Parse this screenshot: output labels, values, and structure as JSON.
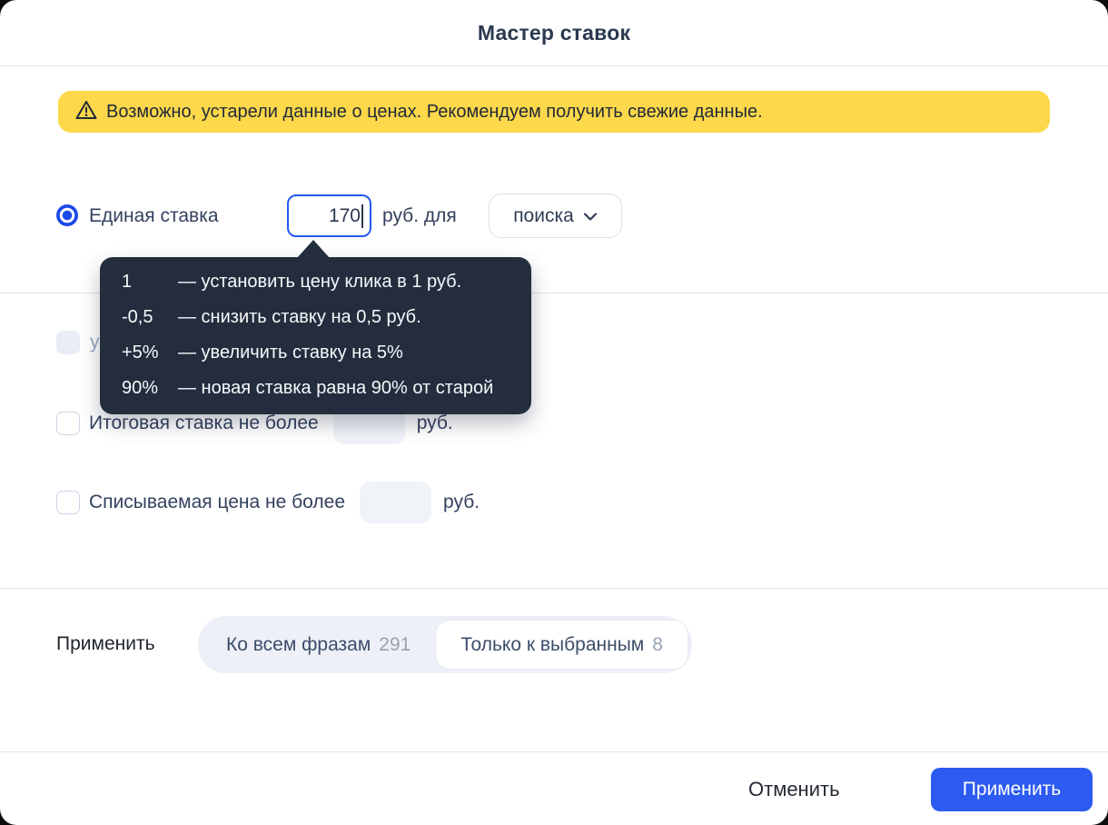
{
  "modal": {
    "title": "Мастер ставок"
  },
  "warning": {
    "icon": "warning-triangle-icon",
    "text": "Возможно, устарели данные о ценах. Рекомендуем получить свежие данные."
  },
  "bid_row": {
    "radio_label": "Единая ставка",
    "bid_value": "170",
    "currency_label": "руб. для",
    "target_select_value": "поиска",
    "target_select_icon": "chevron-down-icon"
  },
  "tooltip": {
    "rows": [
      {
        "example": "1",
        "description": "— установить цену клика в 1 руб."
      },
      {
        "example": "-0,5",
        "description": "— снизить ставку на 0,5 руб."
      },
      {
        "example": "+5%",
        "description": "— увеличить ставку на 5%"
      },
      {
        "example": "90%",
        "description": "— новая ставка равна 90% от старой"
      }
    ]
  },
  "hidden_row": {
    "partial_label": "у"
  },
  "limit_rows": [
    {
      "label": "Итоговая ставка не более",
      "value": "",
      "suffix": "руб."
    },
    {
      "label": "Списываемая цена не более",
      "value": "",
      "suffix": "руб."
    }
  ],
  "apply_scope": {
    "label": "Применить",
    "options": [
      {
        "label": "Ко всем фразам",
        "count": "291",
        "selected": false
      },
      {
        "label": "Только к выбранным",
        "count": "8",
        "selected": true
      }
    ]
  },
  "footer": {
    "cancel_label": "Отменить",
    "apply_label": "Применить"
  },
  "colors": {
    "accent_blue": "#2d5af0",
    "input_border_blue": "#2457f0",
    "radio_blue": "#1d49e8",
    "warning_yellow": "#fcd84a",
    "tooltip_bg": "#232d3d",
    "text_navy": "#33415e",
    "count_grey": "#98a2b3"
  }
}
